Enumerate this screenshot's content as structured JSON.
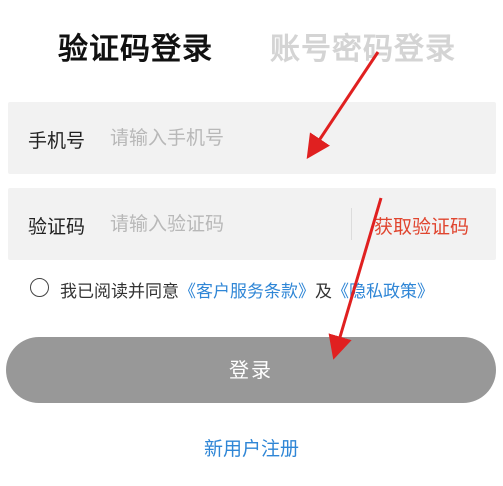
{
  "tabs": {
    "active_label": "验证码登录",
    "inactive_label": "账号密码登录"
  },
  "phone_field": {
    "label": "手机号",
    "placeholder": "请输入手机号",
    "value": ""
  },
  "code_field": {
    "label": "验证码",
    "placeholder": "请输入验证码",
    "value": "",
    "get_code_label": "获取验证码"
  },
  "agreement": {
    "checked": false,
    "prefix": "我已阅读并同意",
    "terms_link": "《客户服务条款》",
    "conjunction": "及",
    "privacy_link": "《隐私政策》"
  },
  "login_button": {
    "label": "登录"
  },
  "register_link": {
    "label": "新用户注册"
  },
  "colors": {
    "accent_red": "#e0452f",
    "link_blue": "#2f86d6",
    "button_gray": "#989898",
    "annotation_arrow": "#e02020"
  }
}
